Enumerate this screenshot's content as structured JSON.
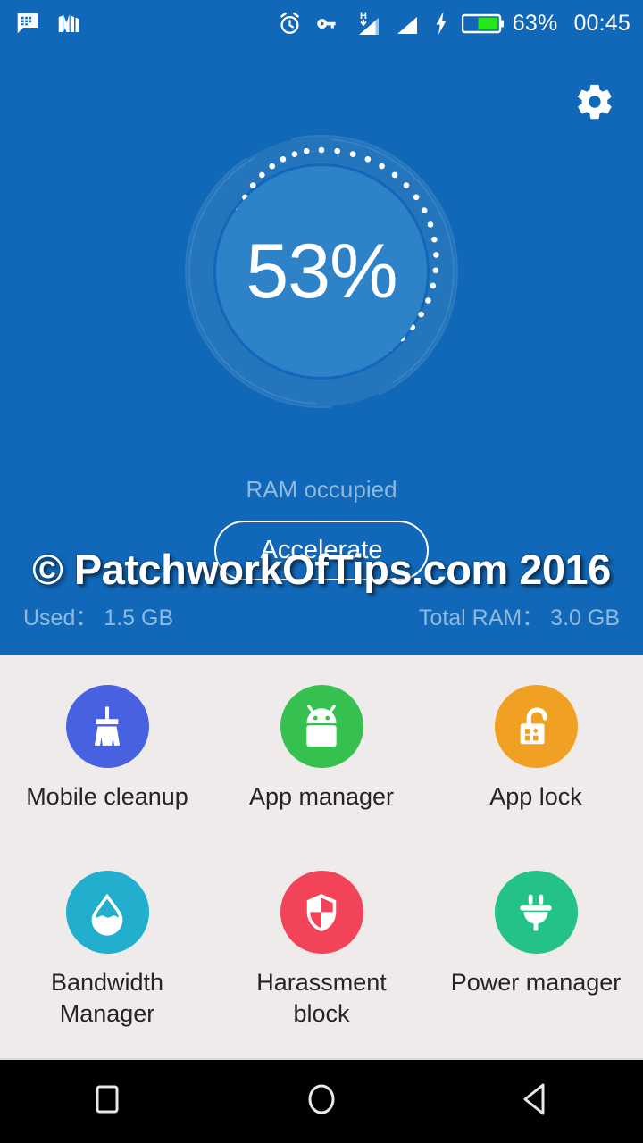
{
  "status_bar": {
    "left_icons": [
      {
        "name": "bbm-chat-icon",
        "label": "BBM"
      },
      {
        "name": "library-books-icon",
        "label": "Library"
      }
    ],
    "right_icons": [
      {
        "name": "alarm-clock-icon",
        "label": "Alarm"
      },
      {
        "name": "vpn-key-icon",
        "label": "VPN"
      },
      {
        "name": "signal-h-icon",
        "label": "H"
      },
      {
        "name": "signal-bars-icon",
        "label": "Signal"
      },
      {
        "name": "charging-bolt-icon",
        "label": "Charging"
      }
    ],
    "network_type": "H",
    "battery_percent": "63%",
    "clock": "00:45"
  },
  "header": {
    "settings_icon": "gear-icon",
    "gauge": {
      "percent_text": "53%",
      "percent_value": 53,
      "caption": "RAM occupied"
    },
    "accelerate_label": "Accelerate",
    "used_label": "Used：",
    "used_value": "1.5 GB",
    "total_label": "Total RAM：",
    "total_value": "3.0 GB",
    "used_line": "Used： 1.5 GB",
    "total_line": "Total RAM： 3.0 GB"
  },
  "watermark": "© PatchworkOfTips.com 2016",
  "tools": [
    {
      "label": "Mobile cleanup",
      "icon": "broom-icon",
      "color": "#4761e0"
    },
    {
      "label": "App manager",
      "icon": "android-robot-icon",
      "color": "#35c04f"
    },
    {
      "label": "App lock",
      "icon": "open-padlock-icon",
      "color": "#f0a022"
    },
    {
      "label": "Bandwidth\nManager",
      "icon": "water-drop-icon",
      "color": "#22aecd"
    },
    {
      "label": "Harassment block",
      "icon": "shield-icon",
      "color": "#f24358"
    },
    {
      "label": "Power manager",
      "icon": "power-plug-icon",
      "color": "#23c287"
    }
  ],
  "tool_labels": {
    "mobile_cleanup": "Mobile cleanup",
    "app_manager": "App manager",
    "app_lock": "App lock",
    "bandwidth_manager_line1": "Bandwidth",
    "bandwidth_manager_line2": "Manager",
    "harassment_block": "Harassment block",
    "power_manager": "Power manager"
  },
  "nav_bar": {
    "recents": "recents-square-icon",
    "home": "home-circle-icon",
    "back": "back-triangle-icon"
  },
  "colors": {
    "header_blue": "#1268b8",
    "gauge_inner": "#2d82c8",
    "panel_gray": "#efebeb",
    "nav_black": "#000000",
    "muted_text": "#8fb9dd"
  }
}
